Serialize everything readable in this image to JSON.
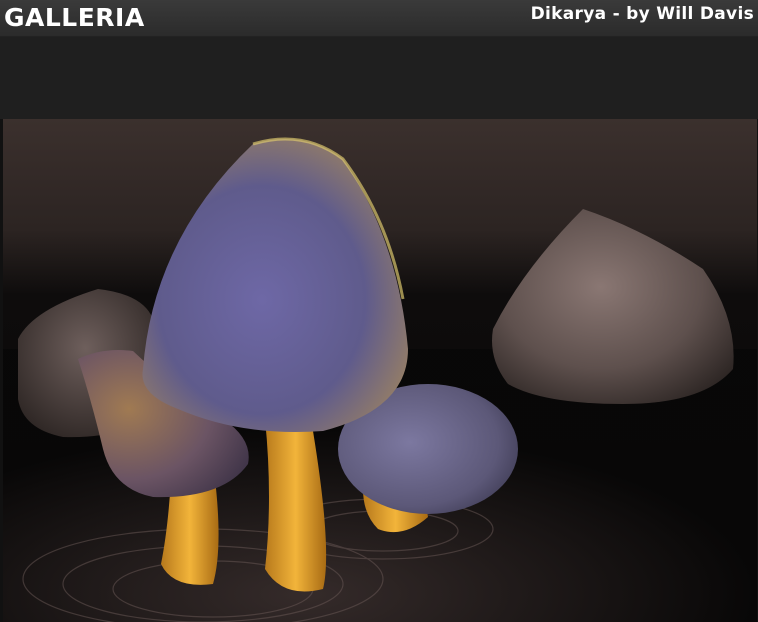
{
  "header": {
    "brand": "GALLERIA",
    "image_caption": "Dikarya - by Will Davis"
  },
  "colors": {
    "header_bg": "#2f2f2f",
    "thumbstrip_bg": "#1f1f1f",
    "text": "#ffffff"
  },
  "image": {
    "subject_icon": "mushroom-render-image"
  }
}
